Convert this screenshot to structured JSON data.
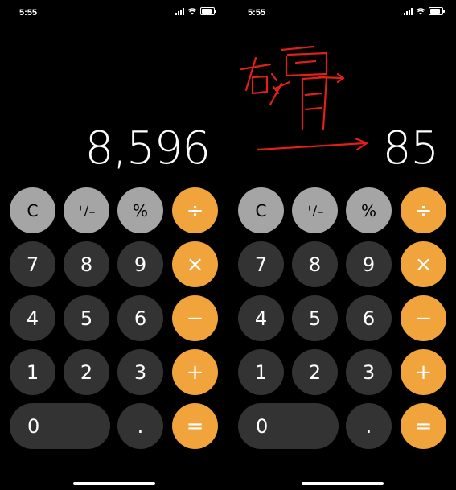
{
  "left": {
    "status_time": "5:55",
    "display_value": "8,596"
  },
  "right": {
    "status_time": "5:55",
    "display_value": "85"
  },
  "keys": {
    "clear": "C",
    "sign": "⁺∕₋",
    "percent": "%",
    "divide": "÷",
    "multiply": "×",
    "minus": "−",
    "plus": "+",
    "equals": "=",
    "decimal": ".",
    "d0": "0",
    "d1": "1",
    "d2": "2",
    "d3": "3",
    "d4": "4",
    "d5": "5",
    "d6": "6",
    "d7": "7",
    "d8": "8",
    "d9": "9"
  },
  "annotation": {
    "handwritten_text": "右滑",
    "color": "#e0201b"
  },
  "colors": {
    "function_key": "#a5a5a5",
    "digit_key": "#333333",
    "operator_key": "#f1a33c",
    "background": "#000000"
  }
}
